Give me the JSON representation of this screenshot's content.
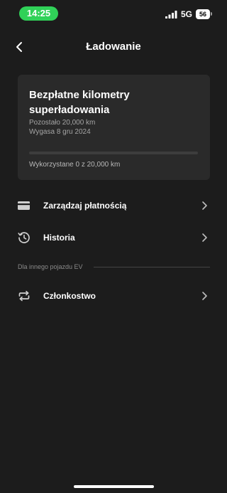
{
  "status_bar": {
    "time": "14:25",
    "network": "5G",
    "battery": "56"
  },
  "header": {
    "title": "Ładowanie"
  },
  "card": {
    "title": "Bezpłatne kilometry superładowania",
    "remaining": "Pozostało 20,000 km",
    "expiry": "Wygasa 8 gru 2024",
    "usage": "Wykorzystane 0 z 20,000 km",
    "progress_fraction": 0
  },
  "menu": {
    "payment": {
      "label": "Zarządzaj płatnością",
      "icon": "credit-card-icon"
    },
    "history": {
      "label": "Historia",
      "icon": "history-clock-icon"
    },
    "section_label": "Dla innego pojazdu EV",
    "membership": {
      "label": "Członkostwo",
      "icon": "repeat-arrows-icon"
    }
  },
  "colors": {
    "background": "#1c1c1c",
    "card": "#2a2a2a",
    "time_pill": "#30d158",
    "text": "#ffffff",
    "muted": "#a4a4a4"
  }
}
